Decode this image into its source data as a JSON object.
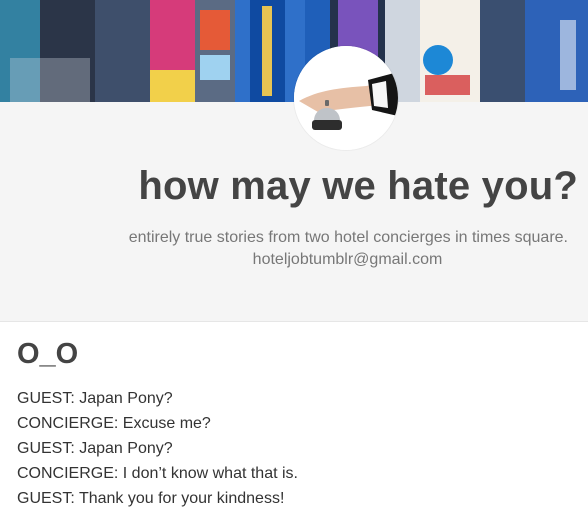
{
  "blog": {
    "title": "how may we hate you?",
    "description": "entirely true stories from two hotel concierges in times square.",
    "email": "hoteljobtumblr@gmail.com"
  },
  "post": {
    "title": "O_O",
    "lines": [
      "GUEST: Japan Pony?",
      "CONCIERGE: Excuse me?",
      "GUEST: Japan Pony?",
      "CONCIERGE: I don’t know what that is.",
      "GUEST: Thank you for your kindness!"
    ]
  },
  "icons": {
    "avatar": "hand-on-service-bell-icon",
    "banner": "times-square-photo"
  },
  "colors": {
    "header_bg": "#f5f5f5",
    "title": "#444444",
    "description": "#777777"
  }
}
